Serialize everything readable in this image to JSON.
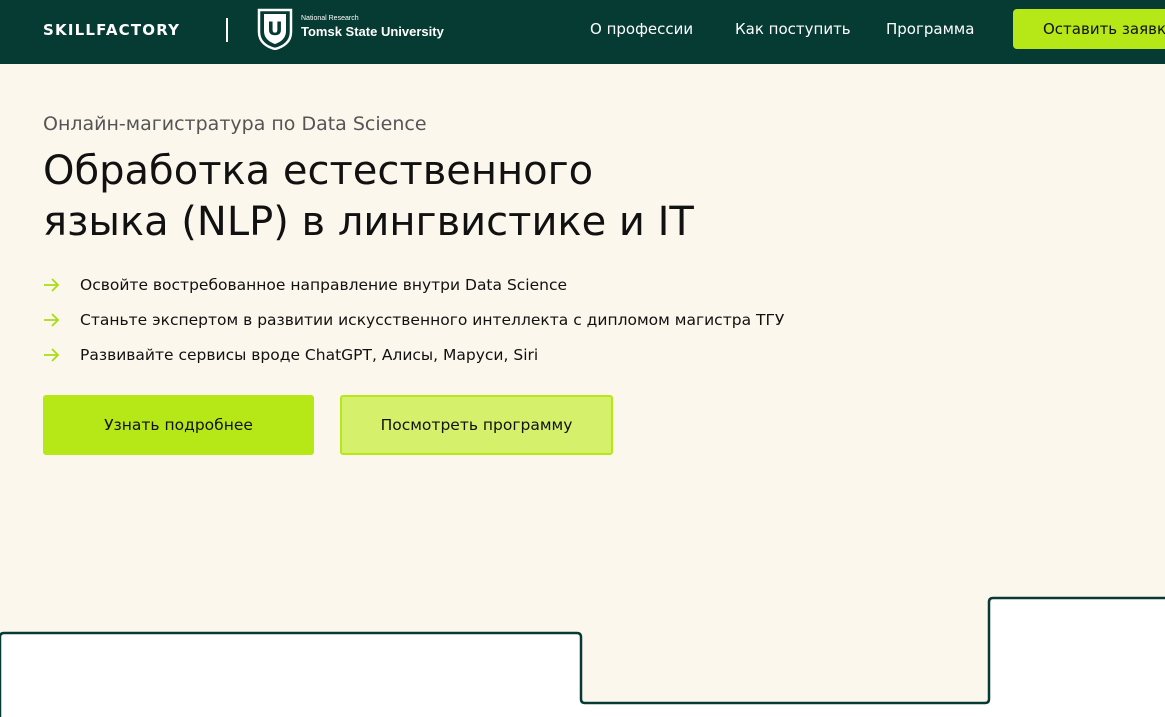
{
  "header": {
    "brand": "SKILLFACTORY",
    "partner_small": "National Research",
    "partner_name": "Tomsk State University",
    "emblem_letter": "U",
    "nav": [
      {
        "label": "О профессии"
      },
      {
        "label": "Как поступить"
      },
      {
        "label": "Программа"
      }
    ],
    "cta_label": "Оставить заявку"
  },
  "hero": {
    "eyebrow": "Онлайн-магистратура по Data Science",
    "title_line1": "Обработка естественного",
    "title_line2": "языка (NLP) в лингвистике и IT",
    "bullets": [
      {
        "text": "Освойте востребованное направление внутри Data Science"
      },
      {
        "text": "Станьте экспертом в развитии искусственного интеллекта с дипломом магистра ТГУ"
      },
      {
        "text": "Развивайте сервисы вроде ChatGPT, Алисы, Маруси, Siri"
      }
    ],
    "primary_button": "Узнать подробнее",
    "secondary_button": "Посмотреть программу"
  },
  "icons": {
    "bullet": "arrow-right-icon",
    "emblem": "tsu-emblem-icon"
  },
  "colors": {
    "header_bg": "#063b34",
    "page_bg": "#fcf7ed",
    "accent": "#b6e817",
    "accent_light": "#d5f06b"
  }
}
